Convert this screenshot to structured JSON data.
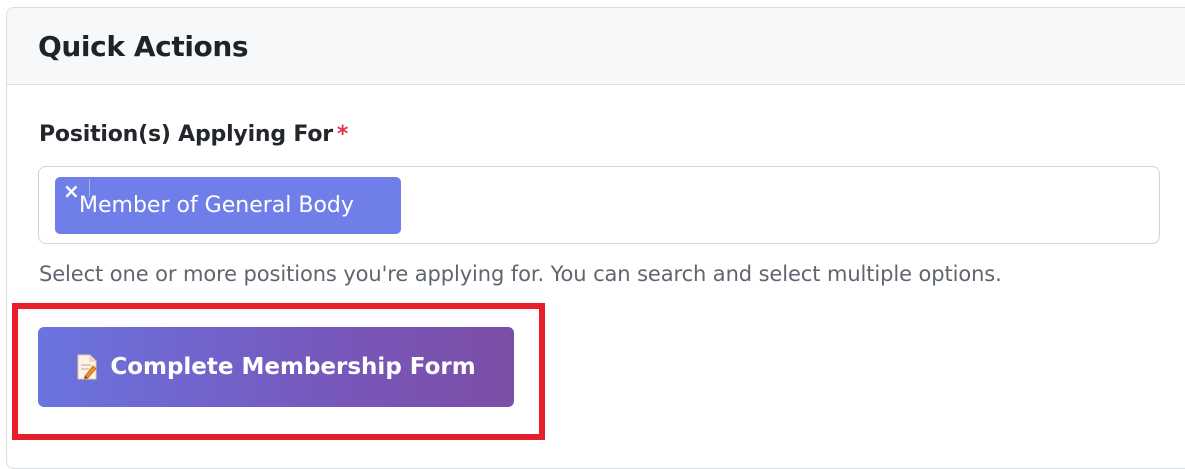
{
  "card": {
    "title": "Quick Actions"
  },
  "form": {
    "position_field": {
      "label": "Position(s) Applying For",
      "required_marker": "*",
      "selected": [
        {
          "label": "Member of General Body",
          "remove_glyph": "×"
        }
      ],
      "help_text": "Select one or more positions you're applying for. You can search and select multiple options."
    }
  },
  "actions": {
    "complete_form": {
      "label": "Complete Membership Form",
      "icon": "memo-document-icon"
    }
  },
  "colors": {
    "chip_background": "#6f7ee8",
    "button_gradient_start": "#6a74e0",
    "button_gradient_end": "#7c4ea6",
    "required_star": "#dc3545",
    "highlight_outline": "#e61f2a"
  }
}
